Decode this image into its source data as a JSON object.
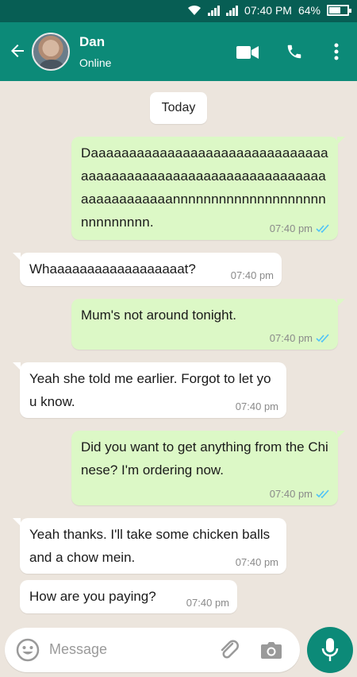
{
  "status_bar": {
    "time": "07:40 PM",
    "battery": "64%",
    "battery_level": 0.64
  },
  "header": {
    "contact_name": "Dan",
    "contact_status": "Online"
  },
  "date_chip": "Today",
  "messages": [
    {
      "direction": "out",
      "text": "Daaaaaaaaaaaaaaaaaaaaaaaaaaaaaaaaaaaaaaaaaaaaaaaaaaaaaaaaaaaaaaaaaaaaaaaaaaannnnnnnnnnnnnnnnnnnnnnnnnnnnn.",
      "time": "07:40 pm",
      "read": true
    },
    {
      "direction": "in",
      "text": "Whaaaaaaaaaaaaaaaaaat?",
      "time": "07:40 pm"
    },
    {
      "direction": "out",
      "text": "Mum's not around tonight.",
      "time": "07:40 pm",
      "read": true
    },
    {
      "direction": "in",
      "text": "Yeah she told me earlier. Forgot to let you know.",
      "time": "07:40 pm"
    },
    {
      "direction": "out",
      "text": "Did you want to get anything from the Chinese? I'm ordering now.",
      "time": "07:40 pm",
      "read": true
    },
    {
      "direction": "in",
      "text": "Yeah thanks. I'll take some chicken balls and a chow mein.",
      "time": "07:40 pm"
    },
    {
      "direction": "in",
      "text": "How are you paying?",
      "time": "07:40 pm"
    }
  ],
  "composer": {
    "placeholder": "Message"
  },
  "colors": {
    "header": "#0c8a78",
    "status_bar": "#075e54",
    "outgoing": "#dcf8c6",
    "incoming": "#ffffff",
    "tick_read": "#4fc3f7"
  },
  "icons": [
    "back-arrow-icon",
    "video-call-icon",
    "voice-call-icon",
    "more-options-icon",
    "emoji-icon",
    "attach-icon",
    "camera-icon",
    "mic-icon",
    "wifi-icon",
    "signal-icon",
    "battery-icon",
    "read-ticks-icon"
  ]
}
